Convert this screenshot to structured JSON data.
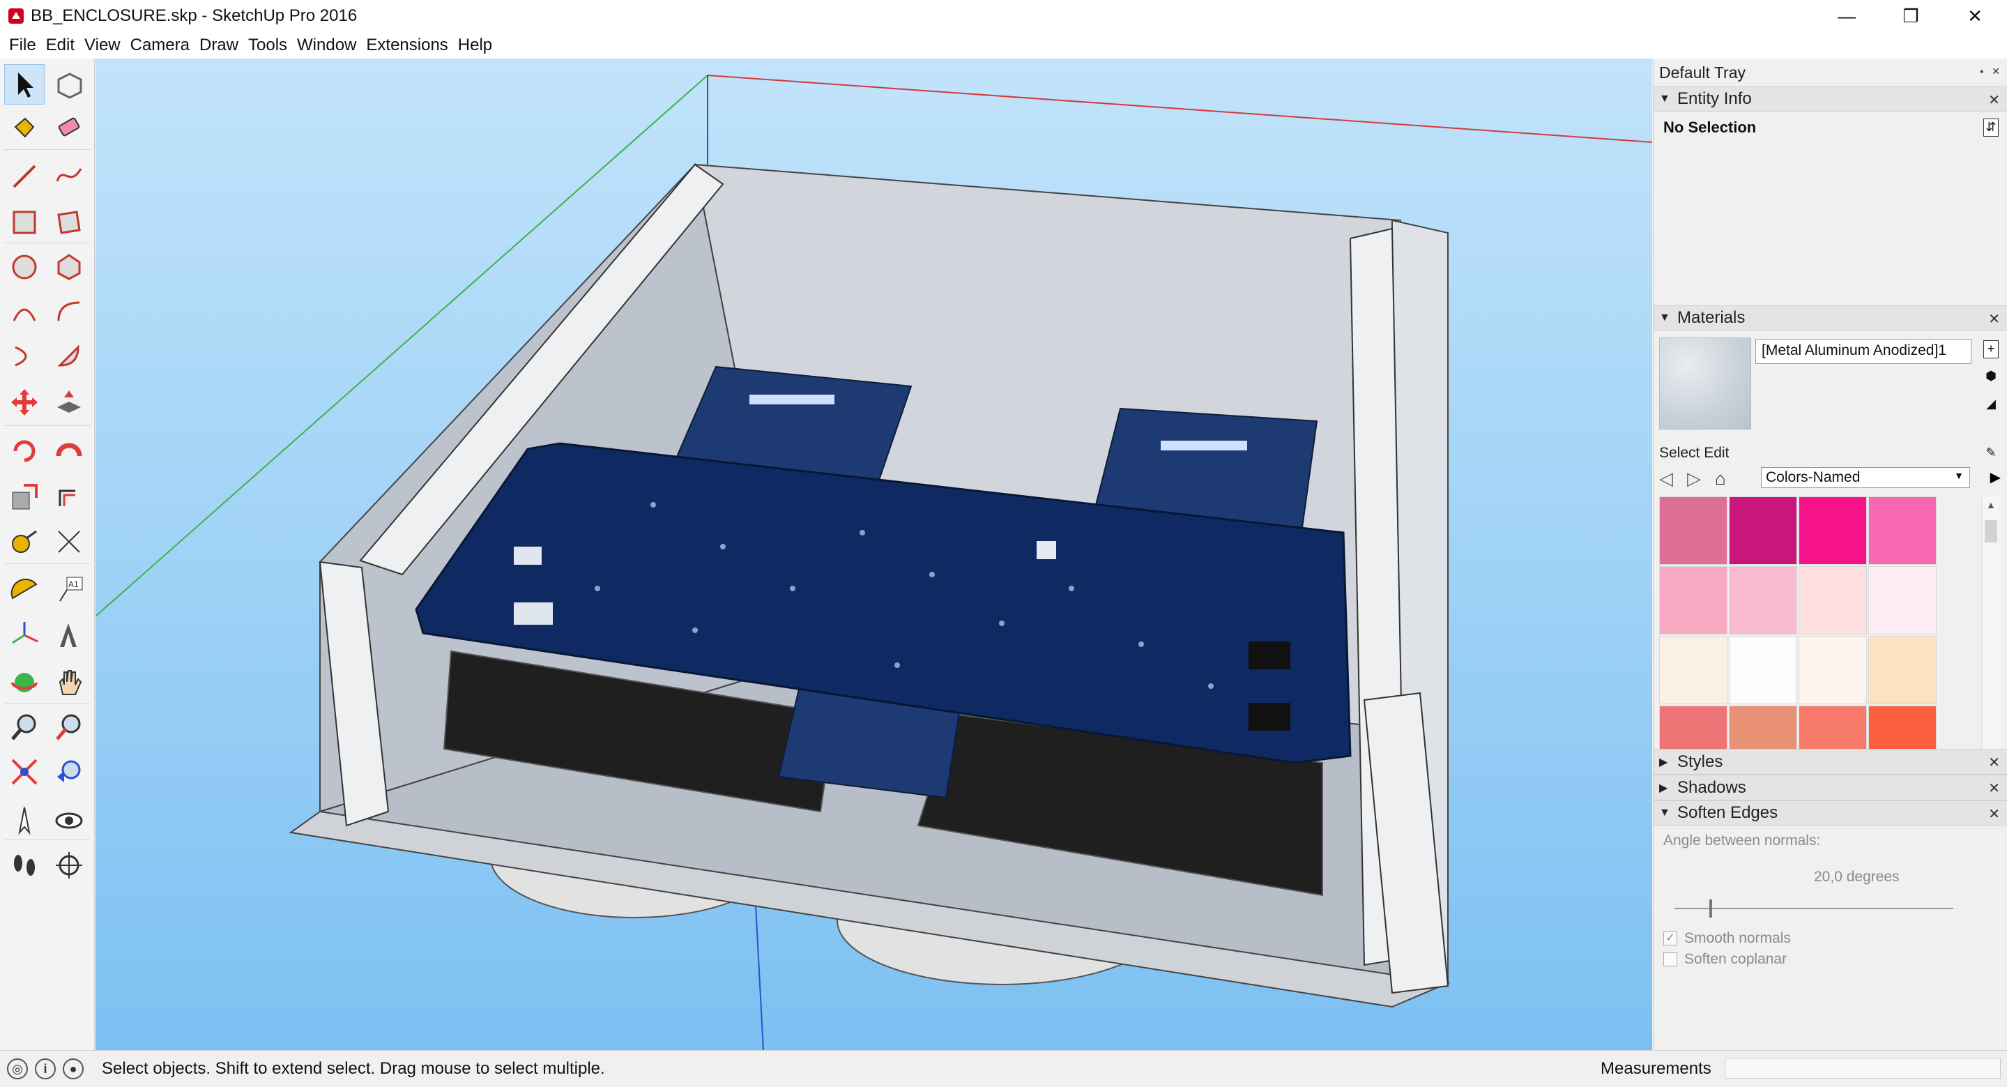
{
  "window": {
    "title": "BB_ENCLOSURE.skp - SketchUp Pro 2016",
    "controls": [
      "—",
      "❐",
      "✕"
    ]
  },
  "menu": [
    "File",
    "Edit",
    "View",
    "Camera",
    "Draw",
    "Tools",
    "Window",
    "Extensions",
    "Help"
  ],
  "toolbar": {
    "tools": [
      "select-icon",
      "make-component-icon",
      "paint-bucket-icon",
      "eraser-icon",
      "line-icon",
      "freehand-icon",
      "rectangle-icon",
      "rotated-rectangle-icon",
      "circle-icon",
      "polygon-icon",
      "arc-icon",
      "two-point-arc-icon",
      "three-point-arc-icon",
      "pie-icon",
      "move-icon",
      "push-pull-icon",
      "rotate-icon",
      "follow-me-icon",
      "scale-icon",
      "offset-icon",
      "tape-measure-icon",
      "dimension-icon",
      "protractor-icon",
      "text-icon",
      "axes-icon",
      "3d-text-icon",
      "orbit-icon",
      "pan-icon",
      "zoom-icon",
      "zoom-window-icon",
      "zoom-extents-icon",
      "previous-view-icon",
      "position-camera-icon",
      "look-around-icon",
      "walk-icon",
      "section-plane-icon"
    ],
    "text_tool_label": "A1"
  },
  "tray": {
    "title": "Default Tray",
    "entity_info": {
      "header": "Entity Info",
      "selection": "No Selection"
    },
    "materials": {
      "header": "Materials",
      "material_name": "[Metal Aluminum Anodized]1",
      "tabs": "Select  Edit",
      "library": "Colors-Named",
      "colors": [
        "#de6f95",
        "#c9167e",
        "#f7128a",
        "#f768b3",
        "#f9a8c2",
        "#f9b9cf",
        "#fde0de",
        "#fdeef3",
        "#fbf0e6",
        "#fefcfa",
        "#fdf4ee",
        "#fde1c1",
        "#ed7375",
        "#e89175",
        "#f77a6b",
        "#fe5f3f"
      ]
    },
    "styles": {
      "header": "Styles"
    },
    "shadows": {
      "header": "Shadows"
    },
    "soften_edges": {
      "header": "Soften Edges",
      "angle_label": "Angle between normals:",
      "angle_value": "20,0  degrees",
      "smooth_normals": "Smooth normals",
      "soften_coplanar": "Soften coplanar"
    }
  },
  "statusbar": {
    "hint": "Select objects. Shift to extend select. Drag mouse to select multiple.",
    "measurements_label": "Measurements"
  }
}
